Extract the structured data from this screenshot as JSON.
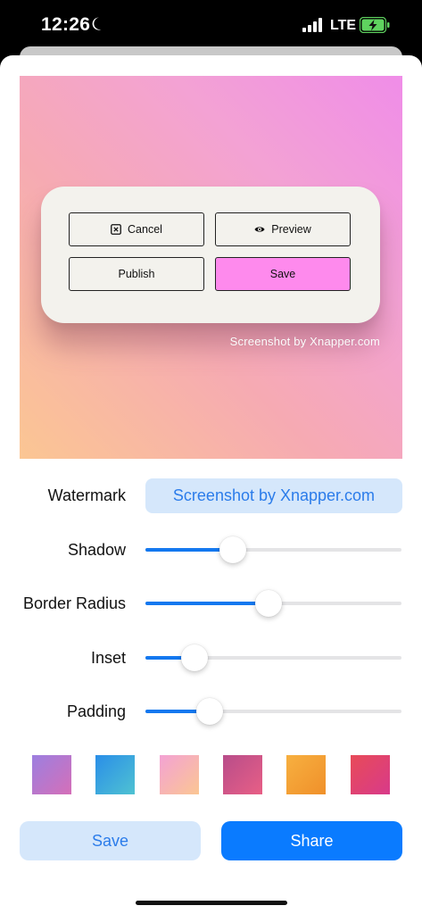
{
  "status_bar": {
    "time": "12:26",
    "network": "LTE",
    "icons": [
      "moon-icon",
      "signal-icon",
      "battery-charging-icon"
    ]
  },
  "preview": {
    "buttons": {
      "cancel": {
        "label": "Cancel",
        "icon": "close-box-icon"
      },
      "preview": {
        "label": "Preview",
        "icon": "eye-icon"
      },
      "publish": {
        "label": "Publish"
      },
      "save": {
        "label": "Save"
      }
    },
    "watermark_text": "Screenshot by Xnapper.com",
    "gradient_colors": [
      "#fbc693",
      "#f6aab3",
      "#f3a2d4",
      "#f08de8"
    ],
    "save_button_color": "#fe8aed"
  },
  "controls": {
    "watermark": {
      "label": "Watermark",
      "value": "Screenshot by Xnapper.com"
    },
    "shadow": {
      "label": "Shadow",
      "value": 0.34
    },
    "border_radius": {
      "label": "Border Radius",
      "value": 0.48
    },
    "inset": {
      "label": "Inset",
      "value": 0.19
    },
    "padding": {
      "label": "Padding",
      "value": 0.25
    }
  },
  "swatches": [
    {
      "name": "purple-gradient",
      "from": "#9c7fe0",
      "to": "#d56fb8"
    },
    {
      "name": "blue-gradient",
      "from": "#2a8ee8",
      "to": "#4fc2d2"
    },
    {
      "name": "pink-peach-gradient",
      "from": "#f3a2d4",
      "to": "#fbc693"
    },
    {
      "name": "magenta-gradient",
      "from": "#b84d8a",
      "to": "#e85f86"
    },
    {
      "name": "orange-gradient",
      "from": "#f7b040",
      "to": "#f0902a"
    },
    {
      "name": "red-pink-gradient",
      "from": "#e84b58",
      "to": "#d83a8a"
    }
  ],
  "actions": {
    "save": "Save",
    "share": "Share"
  },
  "colors": {
    "accent": "#0a7bff",
    "accent_light": "#d5e7fb",
    "slider_fill": "#1478ef"
  }
}
